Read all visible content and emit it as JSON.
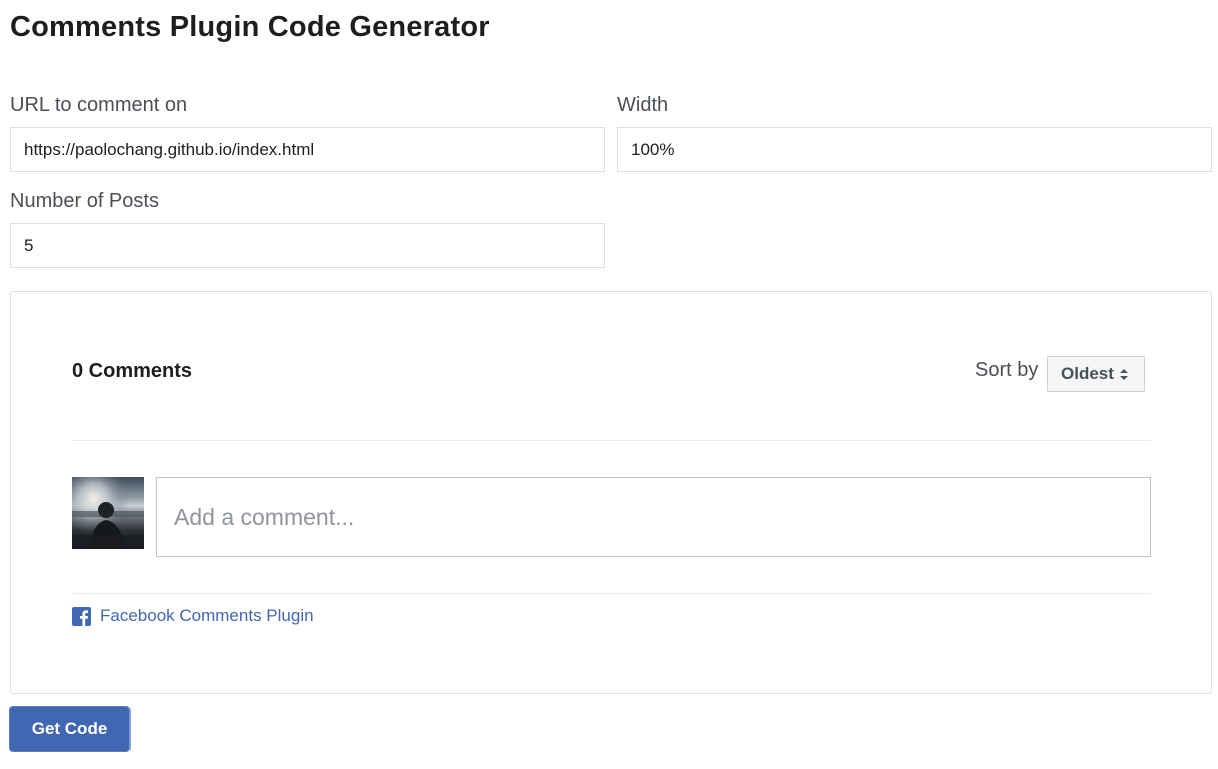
{
  "page": {
    "title": "Comments Plugin Code Generator"
  },
  "form": {
    "url_label": "URL to comment on",
    "url_value": "https://paolochang.github.io/index.html",
    "width_label": "Width",
    "width_value": "100%",
    "posts_label": "Number of Posts",
    "posts_value": "5"
  },
  "preview": {
    "comments_count": "0 Comments",
    "sort_label": "Sort by",
    "sort_value": "Oldest",
    "comment_placeholder": "Add a comment...",
    "plugin_link": "Facebook Comments Plugin"
  },
  "actions": {
    "get_code_label": "Get Code"
  },
  "icons": {
    "facebook": "facebook-f-icon",
    "sort": "sort-arrows-icon"
  },
  "colors": {
    "brand_blue": "#4267b2",
    "text_dark": "#1c1e21",
    "text_muted": "#4b4f56",
    "placeholder": "#90949c",
    "border": "#dddfe2"
  }
}
